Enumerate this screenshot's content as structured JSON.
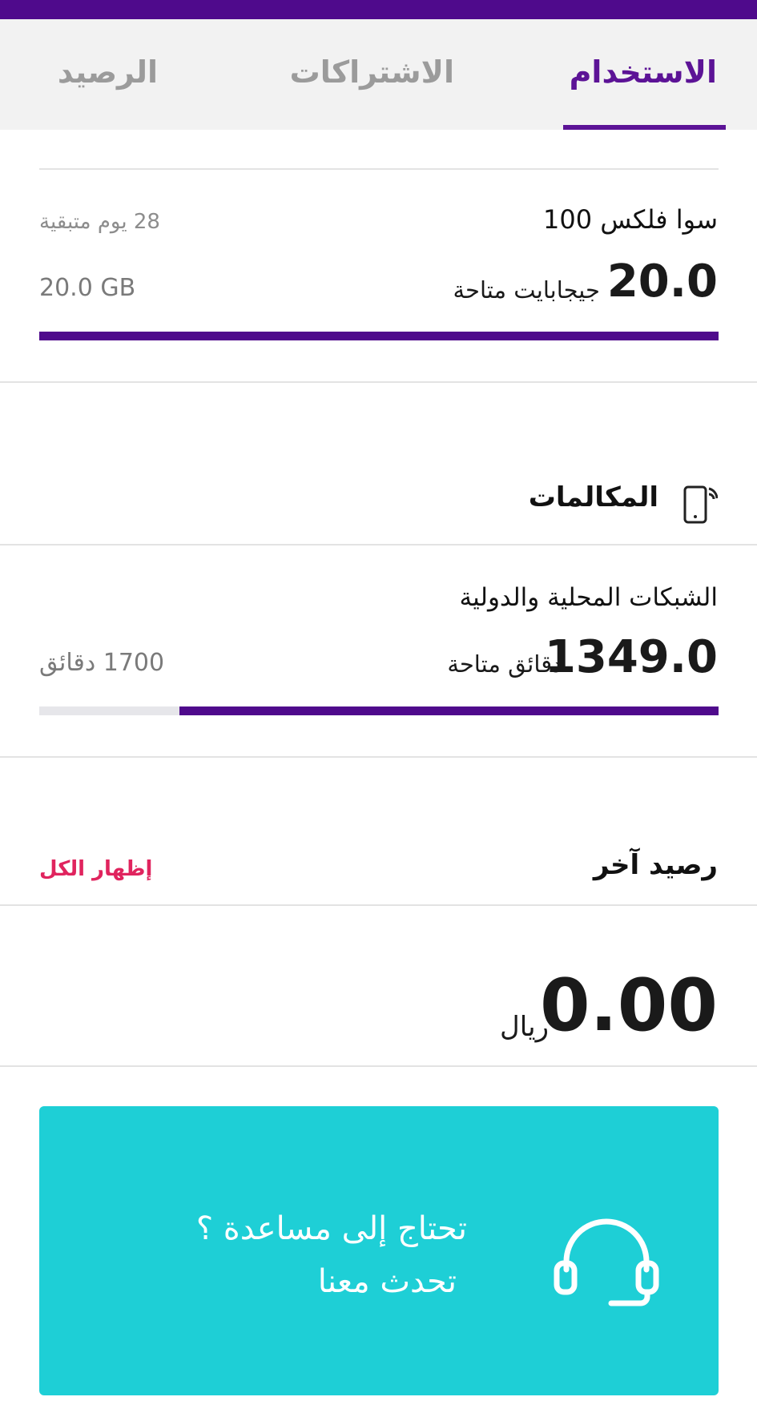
{
  "tabs": [
    {
      "label": "الاستخدام",
      "active": true
    },
    {
      "label": "الاشتراكات",
      "active": false
    },
    {
      "label": "الرصيد",
      "active": false
    }
  ],
  "data_plan": {
    "name": "سوا فلكس 100",
    "remaining_days": "28 يوم متبقية",
    "available_value": "20.0",
    "available_label": "جيجابايت متاحة",
    "total": "20.0 GB",
    "progress_fraction": 1.0
  },
  "calls": {
    "section_title": "المكالمات",
    "icon": "phone-call-icon",
    "network_label": "الشبكات المحلية والدولية",
    "available_value": "1349.0",
    "available_label": "دقائق متاحة",
    "total": "1700 دقائق",
    "progress_fraction": 0.7935
  },
  "other_balance": {
    "title": "رصيد آخر",
    "show_all": "إظهار الكل",
    "amount": "0.00",
    "currency": "ريال"
  },
  "help": {
    "line1": "تحتاج إلى مساعدة ؟",
    "line2": "تحدث معنا",
    "icon": "headset-icon"
  },
  "colors": {
    "brand": "#4f0a8c",
    "accent_link": "#e0245e",
    "help_bg": "#1ecfd6"
  }
}
